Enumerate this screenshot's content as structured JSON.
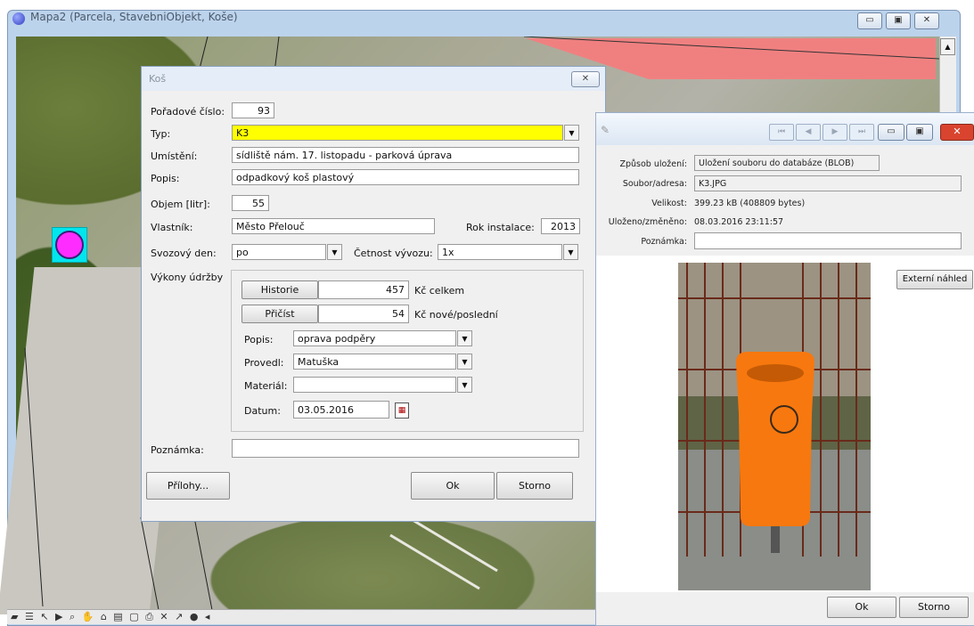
{
  "main_window": {
    "title": "Mapa2 (Parcela, StavebniObjekt, Koše)",
    "min": "▭",
    "max": "▣",
    "close": "✕"
  },
  "kos_dialog": {
    "title": "Koš",
    "close": "✕",
    "poradove_cislo_label": "Pořadové číslo:",
    "poradove_cislo_value": "93",
    "typ_label": "Typ:",
    "typ_value": "K3",
    "umisteni_label": "Umístění:",
    "umisteni_value": "sídliště nám. 17. listopadu - parková úprava",
    "popis_label": "Popis:",
    "popis_value": "odpadkový koš plastový",
    "objem_label": "Objem [litr]:",
    "objem_value": "55",
    "vlastnik_label": "Vlastník:",
    "vlastnik_value": "Město Přelouč",
    "rok_label": "Rok instalace:",
    "rok_value": "2013",
    "svozovy_den_label": "Svozový den:",
    "svozovy_den_value": "po",
    "cetnost_label": "Četnost vývozu:",
    "cetnost_value": "1x",
    "vykony_label": "Výkony údržby",
    "historie_button": "Historie",
    "historie_value": "457",
    "historie_suffix": "Kč celkem",
    "pricist_button": "Přičíst",
    "pricist_value": "54",
    "pricist_suffix": "Kč nové/poslední",
    "u_popis_label": "Popis:",
    "u_popis_value": "oprava podpěry",
    "provedl_label": "Provedl:",
    "provedl_value": "Matuška",
    "material_label": "Materiál:",
    "material_value": "",
    "datum_label": "Datum:",
    "datum_value": "03.05.2016",
    "poznamka_label": "Poznámka:",
    "poznamka_value": "",
    "prilohy_button": "Přílohy...",
    "ok_button": "Ok",
    "storno_button": "Storno"
  },
  "photo_window": {
    "nav_first": "⏮",
    "nav_prev": "◀",
    "nav_next": "▶",
    "nav_last": "⏭",
    "close": "✕",
    "zpusob_label": "Způsob uložení:",
    "zpusob_value": "Uložení souboru do databáze (BLOB)",
    "soubor_label": "Soubor/adresa:",
    "soubor_value": "K3.JPG",
    "velikost_label": "Velikost:",
    "velikost_value": "399.23 kB (408809 bytes)",
    "ulozeno_label": "Uloženo/změněno:",
    "ulozeno_value": "08.03.2016 23:11:57",
    "poznamka_label": "Poznámka:",
    "poznamka_value": "",
    "externi_button": "Externí náhled",
    "ok_button": "Ok",
    "storno_button": "Storno"
  },
  "colors": {
    "typ_highlight": "#ffff00",
    "bin_orange": "#f7780f",
    "map_symbol": "#ff2cff"
  }
}
